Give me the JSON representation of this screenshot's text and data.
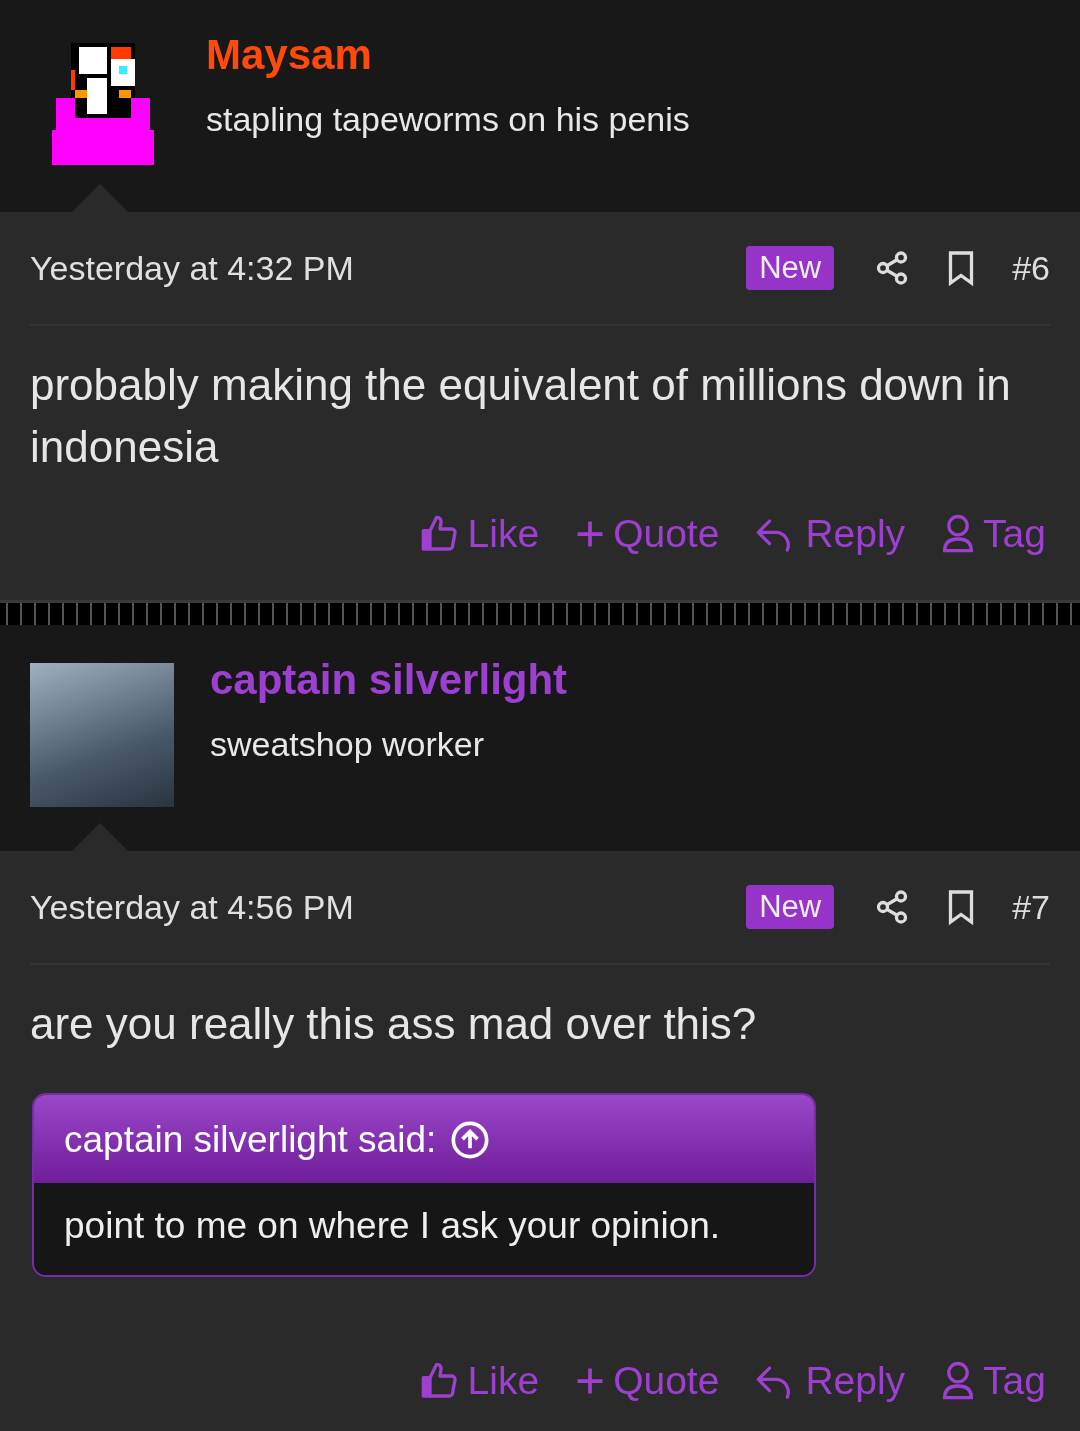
{
  "posts": [
    {
      "user": {
        "name": "Maysam",
        "color": "#ff4a0a",
        "title": "stapling tapeworms on his penis",
        "kind": "pixel"
      },
      "date": "Yesterday at 4:32 PM",
      "new_badge": "New",
      "post_number": "#6",
      "body": "probably making the equivalent of millions down in indonesia",
      "actions": [
        "Like",
        "Quote",
        "Reply",
        "Tag"
      ]
    },
    {
      "user": {
        "name": "captain silverlight",
        "color": "#9d3fd0",
        "title": "sweatshop worker",
        "kind": "photo"
      },
      "date": "Yesterday at 4:56 PM",
      "new_badge": "New",
      "post_number": "#7",
      "body": "are you really this ass mad over this?",
      "quote": {
        "author": "captain silverlight said:",
        "text": "point to me on where I ask your opinion."
      },
      "actions": [
        "Like",
        "Quote",
        "Reply",
        "Tag"
      ]
    }
  ]
}
